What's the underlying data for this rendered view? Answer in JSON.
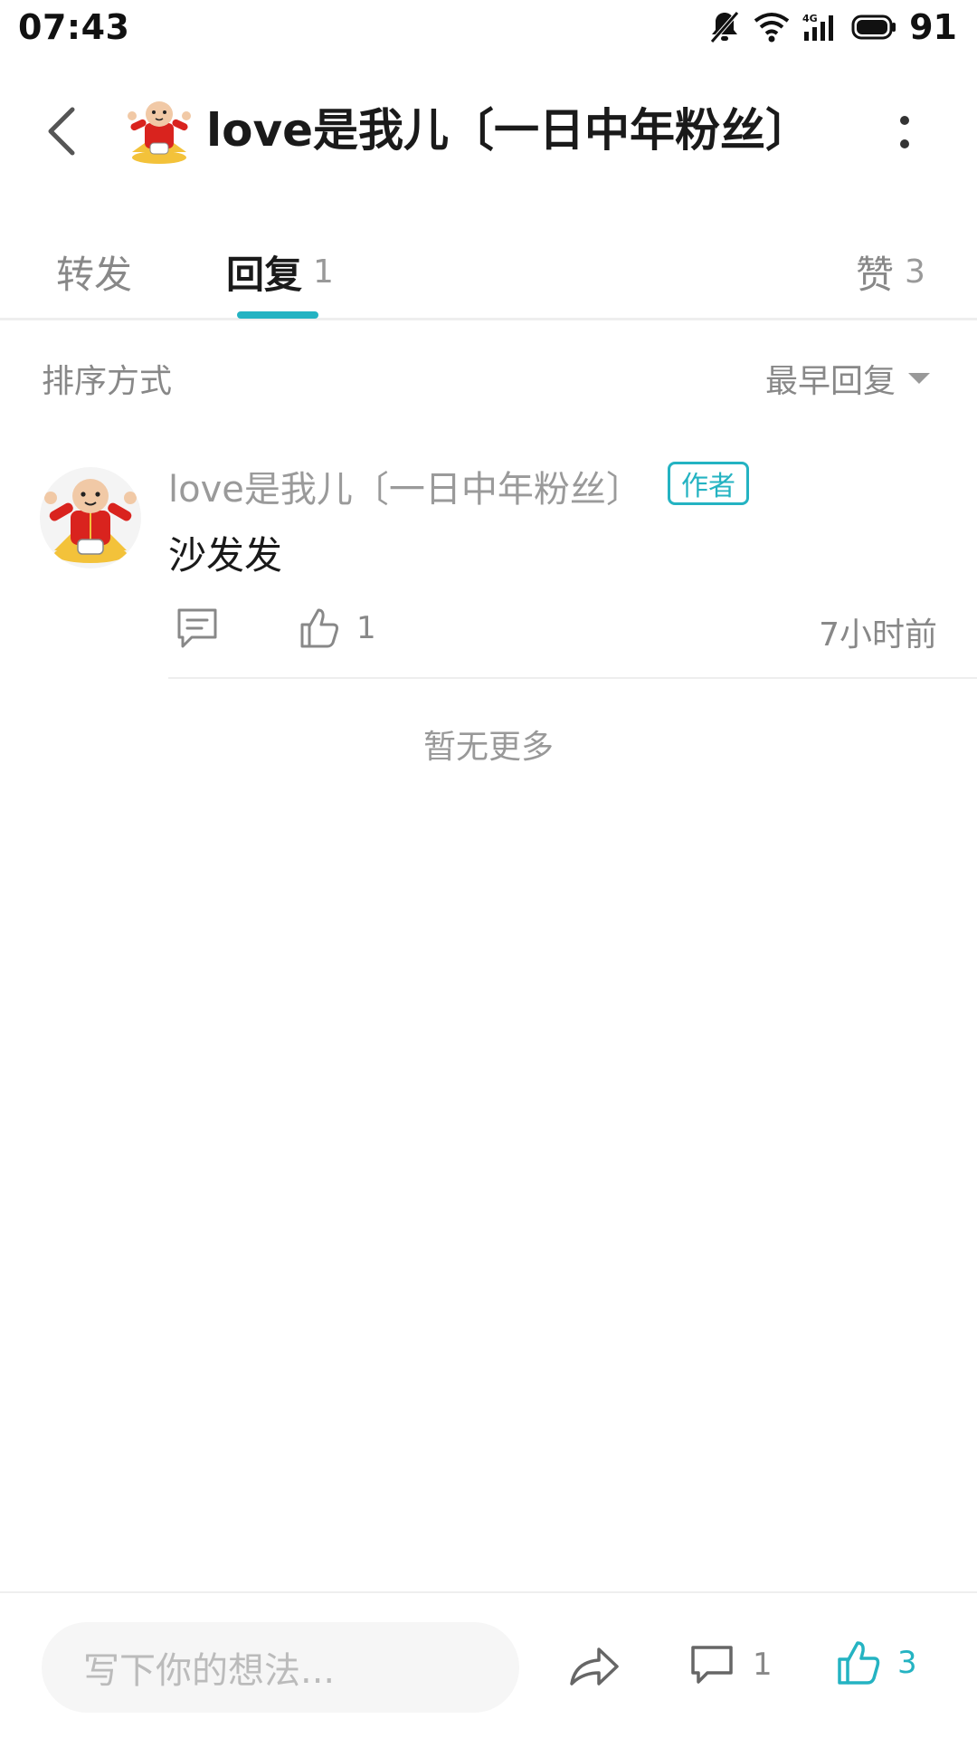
{
  "status_bar": {
    "time": "07:43",
    "network_label": "4G",
    "battery": "91"
  },
  "header": {
    "title": "love是我儿〔一日中年粉丝〕",
    "back_icon": "chevron-left-icon",
    "more_icon": "vertical-dots-icon"
  },
  "tabs": [
    {
      "label": "转发",
      "count": ""
    },
    {
      "label": "回复",
      "count": "1",
      "active": true
    },
    {
      "label": "赞",
      "count": "3"
    }
  ],
  "sort": {
    "label": "排序方式",
    "value": "最早回复"
  },
  "comments": [
    {
      "author": "love是我儿〔一日中年粉丝〕",
      "badge": "作者",
      "text": "沙发发",
      "likes": "1",
      "time": "7小时前"
    }
  ],
  "footer_note": "暂无更多",
  "bottom_bar": {
    "input_placeholder": "写下你的想法...",
    "comment_count": "1",
    "like_count": "3"
  },
  "colors": {
    "accent": "#24b3c2",
    "muted_text": "#888888",
    "primary_text": "#1a1a1a"
  }
}
